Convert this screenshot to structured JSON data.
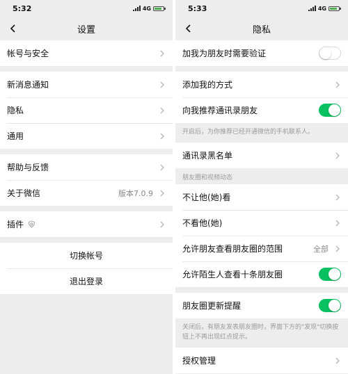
{
  "left": {
    "status": {
      "time": "5:32",
      "network": "4G"
    },
    "title": "设置",
    "groups": [
      [
        {
          "label": "帐号与安全"
        }
      ],
      [
        {
          "label": "新消息通知"
        },
        {
          "label": "隐私"
        },
        {
          "label": "通用"
        }
      ],
      [
        {
          "label": "帮助与反馈"
        },
        {
          "label": "关于微信",
          "value": "版本7.0.9"
        }
      ],
      [
        {
          "label": "插件"
        }
      ]
    ],
    "switch_account": "切换帐号",
    "logout": "退出登录"
  },
  "right": {
    "status": {
      "time": "5:33",
      "network": "4G"
    },
    "title": "隐私",
    "verify_friend": {
      "label": "加我为朋友时需要验证",
      "on": false
    },
    "add_methods": "添加我的方式",
    "recommend_contacts": {
      "label": "向我推荐通讯录朋友",
      "on": true
    },
    "recommend_note": "开启后，为你推荐已经开通微信的手机联系人。",
    "blacklist": "通讯录黑名单",
    "moments_section": "朋友圈和视频动态",
    "dont_let_see": "不让他(她)看",
    "dont_see": "不看他(她)",
    "moments_range": {
      "label": "允许朋友查看朋友圈的范围",
      "value": "全部"
    },
    "stranger_ten": {
      "label": "允许陌生人查看十条朋友圈",
      "on": true
    },
    "moments_remind": {
      "label": "朋友圈更新提醒",
      "on": true
    },
    "remind_note": "关闭后，有朋友发表朋友圈时，界面下方的\"发现\"切换按钮上不再出现红点提示。",
    "auth_manage": "授权管理"
  },
  "colors": {
    "accent": "#07c160",
    "background": "#ededed"
  }
}
